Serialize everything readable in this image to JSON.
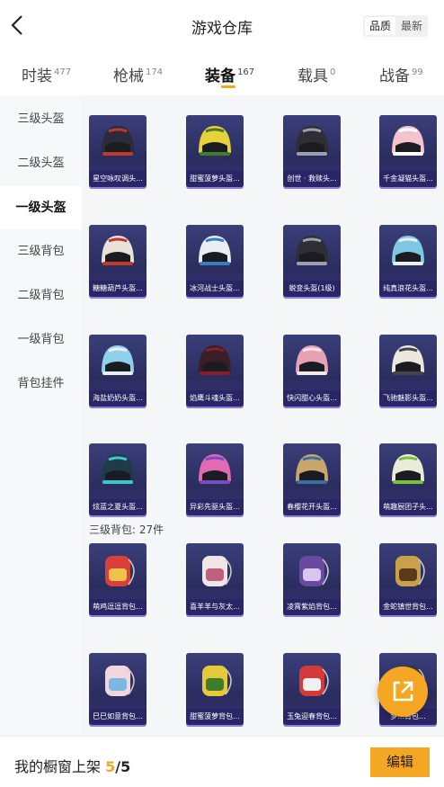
{
  "header": {
    "title": "游戏仓库",
    "sort_options": [
      "品质",
      "最新"
    ]
  },
  "tabs": [
    {
      "label": "时装",
      "count": "477"
    },
    {
      "label": "枪械",
      "count": "174"
    },
    {
      "label": "装备",
      "count": "167"
    },
    {
      "label": "载具",
      "count": "0"
    },
    {
      "label": "战备",
      "count": "99"
    }
  ],
  "sidebar": {
    "items": [
      "三级头盔",
      "二级头盔",
      "一级头盔",
      "三级背包",
      "二级背包",
      "一级背包",
      "背包挂件"
    ]
  },
  "section_backpack": "三级背包: 27件",
  "cards": [
    {
      "label": "星空咏叹调头...",
      "icon": "helmet-black-wings"
    },
    {
      "label": "甜蜜菠萝头盔...",
      "icon": "helmet-pineapple"
    },
    {
      "label": "创世 · 救赎头...",
      "icon": "helmet-black"
    },
    {
      "label": "千金凝猫头盔...",
      "icon": "helmet-pink-cat"
    },
    {
      "label": "糖糖葫芦头盔...",
      "icon": "helmet-red-white"
    },
    {
      "label": "冰河战士头盔...",
      "icon": "helmet-blue-white"
    },
    {
      "label": "蜕变头盔(1级)",
      "icon": "helmet-black"
    },
    {
      "label": "纯真浪花头盔...",
      "icon": "helmet-light-blue"
    },
    {
      "label": "海盐奶奶头盔...",
      "icon": "helmet-sky-blue"
    },
    {
      "label": "焰鹰斗魂头盔...",
      "icon": "helmet-dark-red"
    },
    {
      "label": "快闪甜心头盔...",
      "icon": "helmet-pink"
    },
    {
      "label": "飞驰魅影头盔...",
      "icon": "helmet-white"
    },
    {
      "label": "炫蓝之夏头盔...",
      "icon": "helmet-teal"
    },
    {
      "label": "异彩先驱头盔...",
      "icon": "helmet-purple"
    },
    {
      "label": "春樱花开头盔...",
      "icon": "helmet-gold"
    },
    {
      "label": "萌趣厨团子头...",
      "icon": "helmet-green"
    },
    {
      "label": "萌鸡逗逗背包...",
      "icon": "backpack-chicken"
    },
    {
      "label": "喜羊羊与灰太...",
      "icon": "backpack-sheep"
    },
    {
      "label": "凌霄紫焰背包...",
      "icon": "backpack-purple"
    },
    {
      "label": "金蛇镇世背包...",
      "icon": "backpack-gold-snake"
    },
    {
      "label": "巳巳如意背包...",
      "icon": "backpack-pink"
    },
    {
      "label": "甜蜜菠萝背包...",
      "icon": "backpack-pineapple"
    },
    {
      "label": "玉兔迎春背包...",
      "icon": "backpack-red"
    },
    {
      "label": "梦...背包...",
      "icon": "backpack-dark"
    }
  ],
  "bottom": {
    "shelf_label": "我的橱窗上架",
    "shelf_count": "5",
    "shelf_total": "/5",
    "edit_label": "编辑"
  },
  "colors": {
    "accent": "#f5a623",
    "card_bg": "#2a2d5e",
    "card_border": "#8e7ee0"
  }
}
